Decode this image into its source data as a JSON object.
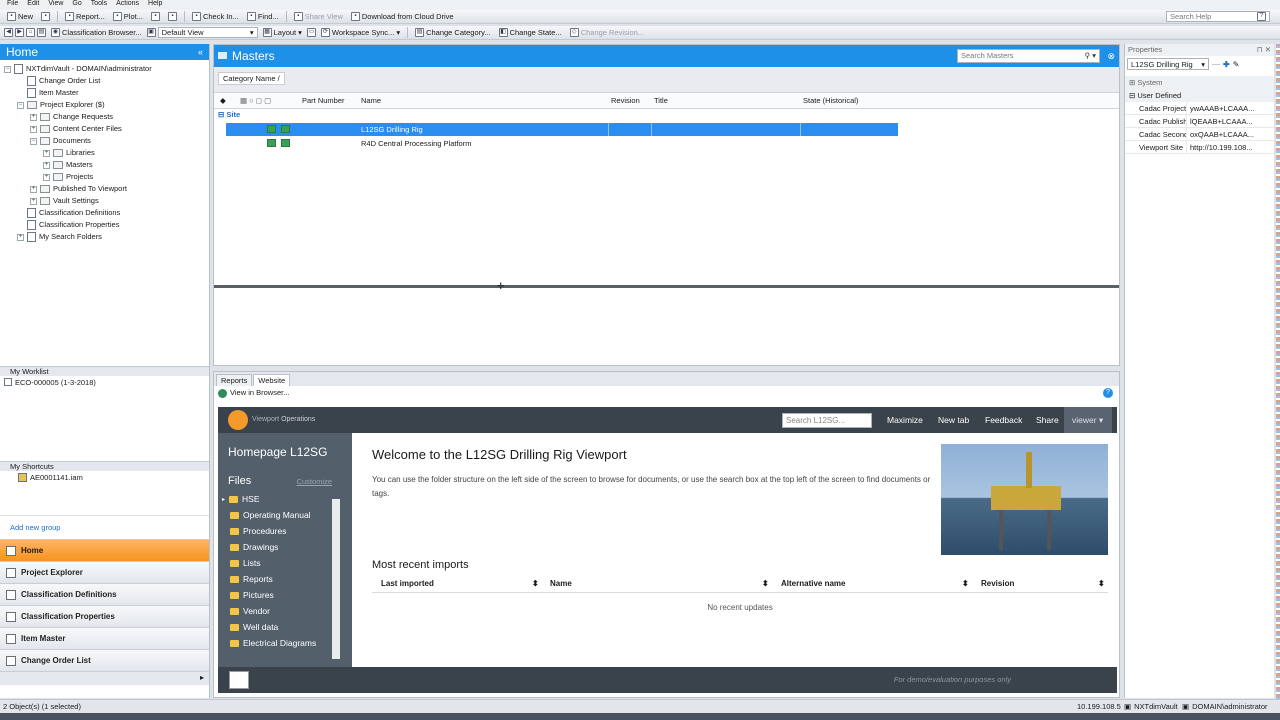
{
  "menu": [
    "File",
    "Edit",
    "View",
    "Go",
    "Tools",
    "Actions",
    "Help"
  ],
  "toolbar1": [
    {
      "label": "New",
      "icon": "new-doc-icon"
    },
    {
      "label": "",
      "icon": "refresh-icon"
    },
    {
      "label": "Report...",
      "icon": "report-icon"
    },
    {
      "label": "Plot...",
      "icon": "plot-icon"
    },
    {
      "label": "",
      "icon": "print-icon"
    },
    {
      "label": "",
      "icon": "delete-icon"
    },
    {
      "label": "Check In...",
      "icon": "check-in-icon"
    },
    {
      "label": "Find...",
      "icon": "find-icon"
    },
    {
      "label": "Share View",
      "icon": "share-view-icon",
      "disabled": true
    },
    {
      "label": "Download from Cloud Drive",
      "icon": "cloud-download-icon"
    }
  ],
  "search_help": {
    "placeholder": "Search Help"
  },
  "toolbar2": {
    "classification_browser": "Classification Browser...",
    "view_select": "Default View",
    "layout": "Layout",
    "workspace_sync": "Workspace Sync...",
    "change_category": "Change Category...",
    "change_state": "Change State...",
    "change_revision": "Change Revision..."
  },
  "left": {
    "title": "Home",
    "tree": [
      {
        "label": "NXTdimVault - DOMAIN\\administrator",
        "indent": 0,
        "exp": "-",
        "kind": "vault"
      },
      {
        "label": "Change Order List",
        "indent": 1,
        "exp": "",
        "kind": "doc"
      },
      {
        "label": "Item Master",
        "indent": 1,
        "exp": "",
        "kind": "doc"
      },
      {
        "label": "Project Explorer ($)",
        "indent": 1,
        "exp": "-",
        "kind": "folder"
      },
      {
        "label": "Change Requests",
        "indent": 2,
        "exp": "+",
        "kind": "folder"
      },
      {
        "label": "Content Center Files",
        "indent": 2,
        "exp": "+",
        "kind": "folder"
      },
      {
        "label": "Documents",
        "indent": 2,
        "exp": "-",
        "kind": "folder"
      },
      {
        "label": "Libraries",
        "indent": 3,
        "exp": "+",
        "kind": "folder"
      },
      {
        "label": "Masters",
        "indent": 3,
        "exp": "+",
        "kind": "folder"
      },
      {
        "label": "Projects",
        "indent": 3,
        "exp": "+",
        "kind": "folder"
      },
      {
        "label": "Published To Viewport",
        "indent": 2,
        "exp": "+",
        "kind": "folder"
      },
      {
        "label": "Vault Settings",
        "indent": 2,
        "exp": "+",
        "kind": "folder"
      },
      {
        "label": "Classification Definitions",
        "indent": 1,
        "exp": "",
        "kind": "doc"
      },
      {
        "label": "Classification Properties",
        "indent": 1,
        "exp": "",
        "kind": "doc"
      },
      {
        "label": "My Search Folders",
        "indent": 1,
        "exp": "+",
        "kind": "search"
      }
    ],
    "worklist_title": "My Worklist",
    "worklist_item": "ECO-000005 (1-3-2018)",
    "shortcuts_title": "My Shortcuts",
    "shortcut_item": "AE0001141.iam",
    "add_group": "Add new group",
    "nav": [
      "Home",
      "Project Explorer",
      "Classification Definitions",
      "Classification Properties",
      "Item Master",
      "Change Order List"
    ]
  },
  "masters": {
    "title": "Masters",
    "search_placeholder": "Search Masters",
    "group_chip": "Category Name",
    "columns": {
      "part_number": "Part Number",
      "name": "Name",
      "revision": "Revision",
      "title": "Title",
      "state": "State (Historical)"
    },
    "group_label": "Site",
    "rows": [
      {
        "name": "L12SG Drilling Rig",
        "selected": true
      },
      {
        "name": "R4D Central Processing Platform",
        "selected": false
      }
    ]
  },
  "bottom": {
    "tabs": [
      "Reports",
      "Website"
    ],
    "view_in_browser": "View in Browser...",
    "web": {
      "brand": "Viewport",
      "brand2": "Operations",
      "search_placeholder": "Search L12SG...",
      "menu": [
        "Maximize",
        "New tab",
        "Feedback",
        "Share"
      ],
      "user": "viewer",
      "homepage": "Homepage L12SG",
      "files": "Files",
      "customize": "Customize",
      "folders": [
        "HSE",
        "Operating Manual",
        "Procedures",
        "Drawings",
        "Lists",
        "Reports",
        "Pictures",
        "Vendor",
        "Well data",
        "Electrical Diagrams"
      ],
      "welcome": "Welcome to the L12SG Drilling Rig Viewport",
      "intro": "You can use the folder structure on the left side of the screen to browse for documents, or use the search box at the top left of the screen to find documents or tags.",
      "recent_title": "Most recent imports",
      "recent_cols": [
        "Last imported",
        "Name",
        "Alternative name",
        "Revision"
      ],
      "no_updates": "No recent updates",
      "footer": "For demo/evaluation purposes only"
    }
  },
  "properties": {
    "title": "Properties",
    "selected": "L12SG Drilling Rig",
    "group_system": "System",
    "group_user": "User Defined",
    "rows": [
      {
        "key": "Cadac Project ...",
        "val": "ywAAAB+LCAAA..."
      },
      {
        "key": "Cadac Publish ...",
        "val": "lQEAAB+LCAAA..."
      },
      {
        "key": "Cadac Second...",
        "val": "oxQAAB+LCAAA..."
      },
      {
        "key": "Viewport Site",
        "val": "http://10.199.108..."
      }
    ]
  },
  "status": {
    "left": "2 Object(s) (1 selected)",
    "ip": "10.199.108.5",
    "vault": "NXTdimVault",
    "user": "DOMAIN\\administrator"
  },
  "colors": {
    "accent": "#1e90e8",
    "selection": "#2a8df0",
    "nav_active": "#f7941d"
  }
}
